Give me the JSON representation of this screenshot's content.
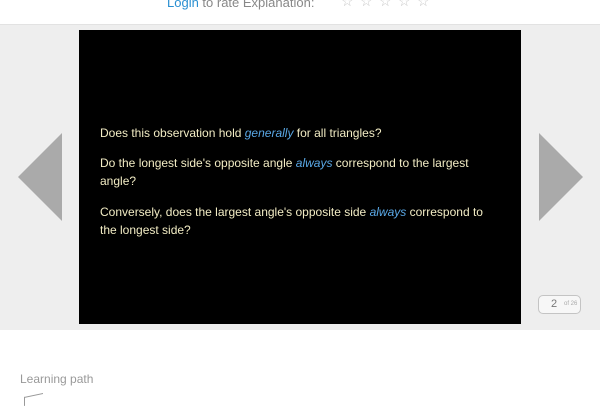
{
  "header": {
    "login_label": "Login",
    "rate_text": " to rate Explanation:",
    "stars": [
      "☆",
      "☆",
      "☆",
      "☆",
      "☆"
    ]
  },
  "slide": {
    "q1": {
      "a": "Does this observation hold ",
      "em": "generally",
      "b": " for all triangles?"
    },
    "q2": {
      "a": "Do the longest side's opposite angle ",
      "em": "always",
      "b": " correspond to the largest angle?"
    },
    "q3": {
      "a": "Conversely, does the largest angle's opposite side ",
      "em": "always",
      "b": " correspond to the longest side?"
    }
  },
  "pager": {
    "current": "2",
    "total": "of 26"
  },
  "footer": {
    "learning_path_label": "Learning path"
  },
  "colors": {
    "slide_bg": "#000000",
    "slide_text": "#f2ecc4",
    "emphasis": "#5aa8e6",
    "link": "#2a8fd1",
    "arrow": "#aaaaaa",
    "stage_bg": "#eeeeee"
  }
}
